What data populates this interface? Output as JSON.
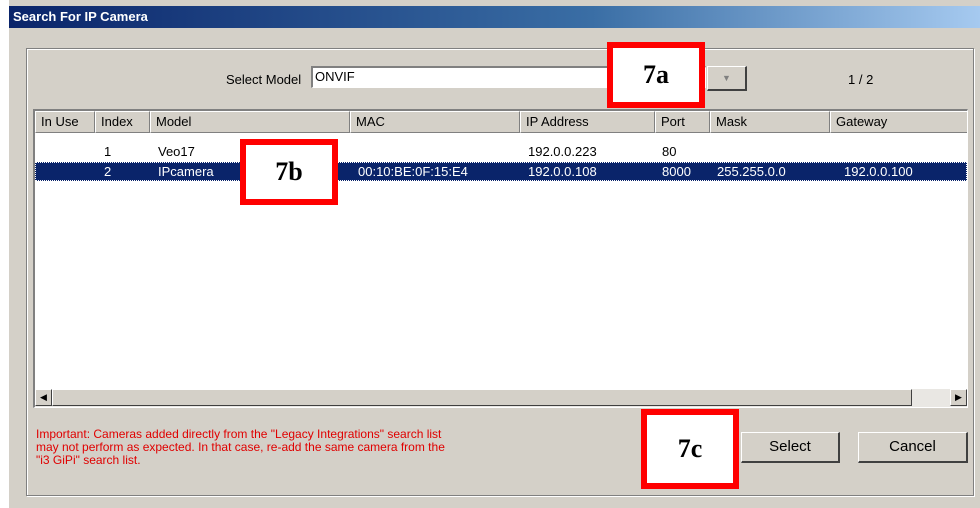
{
  "window": {
    "title": "Search For IP Camera"
  },
  "model_select": {
    "label": "Select Model",
    "value": "ONVIF",
    "page_indicator": "1 / 2"
  },
  "table": {
    "columns": [
      "In Use",
      "Index",
      "Model",
      "MAC",
      "IP Address",
      "Port",
      "Mask",
      "Gateway"
    ],
    "rows": [
      {
        "in_use": "",
        "index": "1",
        "model": "Veo17",
        "mac": "",
        "ip": "192.0.0.223",
        "port": "80",
        "mask": "",
        "gateway": ""
      },
      {
        "in_use": "",
        "index": "2",
        "model": "IPcamera",
        "mac": "00:10:BE:0F:15:E4",
        "ip": "192.0.0.108",
        "port": "8000",
        "mask": "255.255.0.0",
        "gateway": "192.0.0.100",
        "selected": true
      }
    ]
  },
  "notice": {
    "line1": "Important: Cameras added directly from the \"Legacy Integrations\" search list",
    "line2": "may not perform as expected. In that case, re-add the same camera from the",
    "line3": "\"i3 GiPi\" search list."
  },
  "buttons": {
    "select": "Select",
    "cancel": "Cancel"
  },
  "callouts": {
    "a": "7a",
    "b": "7b",
    "c": "7c"
  },
  "colors": {
    "selection": "#0a246a",
    "callout_border": "#ff0000",
    "notice_text": "#e00000"
  }
}
